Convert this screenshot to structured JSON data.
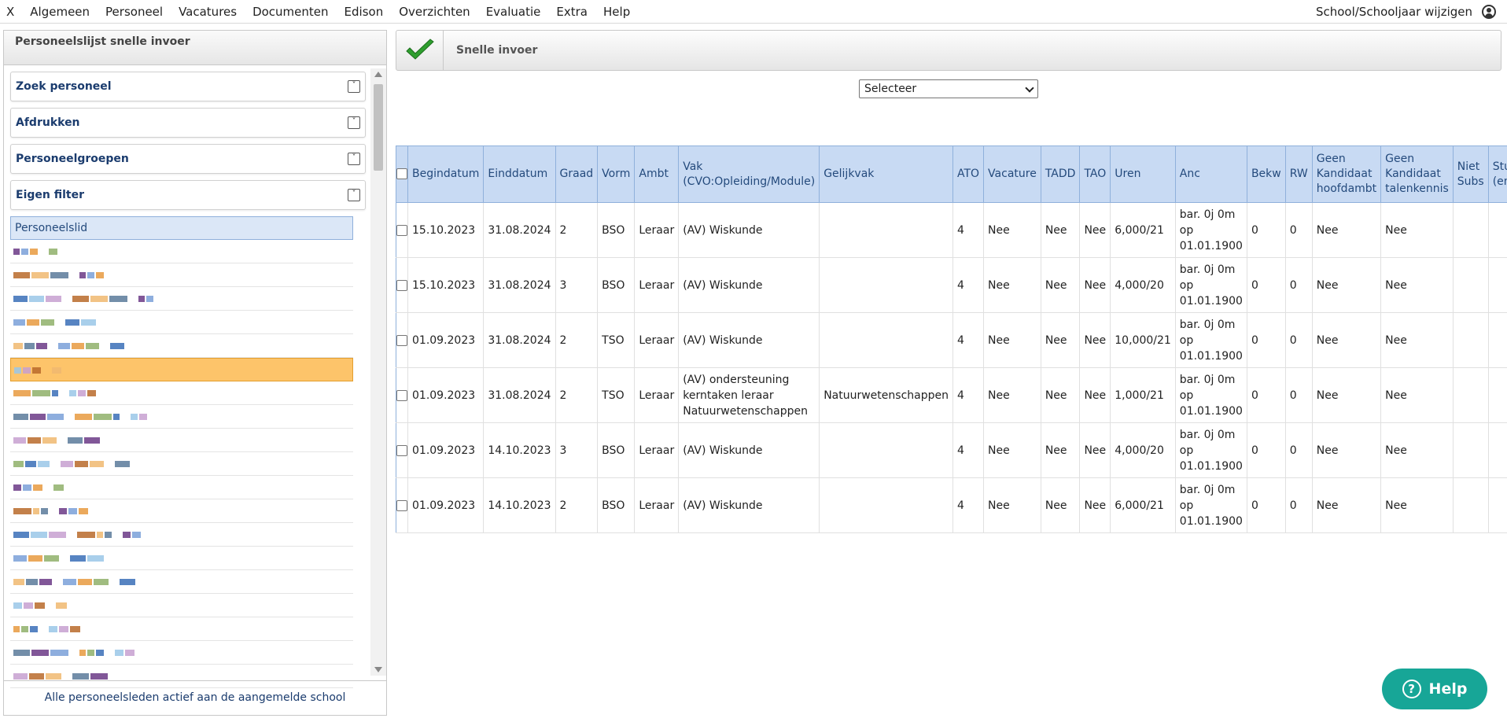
{
  "menubar": {
    "items": [
      "X",
      "Algemeen",
      "Personeel",
      "Vacatures",
      "Documenten",
      "Edison",
      "Overzichten",
      "Evaluatie",
      "Extra",
      "Help"
    ],
    "right_label": "School/Schooljaar wijzigen",
    "user_icon": "user-circle-icon"
  },
  "left_panel": {
    "title": "Personeelslijst snelle invoer",
    "sections": [
      "Zoek personeel",
      "Afdrukken",
      "Personeelgroepen",
      "Eigen filter"
    ],
    "list_header": "Personeelslid",
    "selected_row_index": 5,
    "footer": "Alle personeelsleden actief aan de aangemelde school"
  },
  "toolbar": {
    "title": "Snelle invoer",
    "save_icon": "checkmark-icon"
  },
  "select": {
    "value": "Selecteer"
  },
  "table": {
    "headers": [
      "Begindatum",
      "Einddatum",
      "Graad",
      "Vorm",
      "Ambt",
      "Vak (CVO:Opleiding/Module)",
      "Gelijkvak",
      "ATO",
      "Vacature",
      "TADD",
      "TAO",
      "Uren",
      "Anc",
      "Bekw",
      "RW",
      "Geen Kandidaat hoofdambt",
      "Geen Kandidaat talenkennis",
      "Niet Subs",
      "Studiegebied (enkel CVO)"
    ],
    "rows": [
      [
        "15.10.2023",
        "31.08.2024",
        "2",
        "BSO",
        "Leraar",
        "(AV) Wiskunde",
        "",
        "4",
        "Nee",
        "Nee",
        "Nee",
        "6,000/21",
        "bar. 0j 0m op 01.01.1900",
        "0",
        "0",
        "Nee",
        "Nee",
        "",
        ""
      ],
      [
        "15.10.2023",
        "31.08.2024",
        "3",
        "BSO",
        "Leraar",
        "(AV) Wiskunde",
        "",
        "4",
        "Nee",
        "Nee",
        "Nee",
        "4,000/20",
        "bar. 0j 0m op 01.01.1900",
        "0",
        "0",
        "Nee",
        "Nee",
        "",
        ""
      ],
      [
        "01.09.2023",
        "31.08.2024",
        "2",
        "TSO",
        "Leraar",
        "(AV) Wiskunde",
        "",
        "4",
        "Nee",
        "Nee",
        "Nee",
        "10,000/21",
        "bar. 0j 0m op 01.01.1900",
        "0",
        "0",
        "Nee",
        "Nee",
        "",
        ""
      ],
      [
        "01.09.2023",
        "31.08.2024",
        "2",
        "TSO",
        "Leraar",
        "(AV) ondersteuning kerntaken leraar Natuurwetenschappen",
        "Natuurwetenschappen",
        "4",
        "Nee",
        "Nee",
        "Nee",
        "1,000/21",
        "bar. 0j 0m op 01.01.1900",
        "0",
        "0",
        "Nee",
        "Nee",
        "",
        ""
      ],
      [
        "01.09.2023",
        "14.10.2023",
        "3",
        "BSO",
        "Leraar",
        "(AV) Wiskunde",
        "",
        "4",
        "Nee",
        "Nee",
        "Nee",
        "4,000/20",
        "bar. 0j 0m op 01.01.1900",
        "0",
        "0",
        "Nee",
        "Nee",
        "",
        ""
      ],
      [
        "01.09.2023",
        "14.10.2023",
        "2",
        "BSO",
        "Leraar",
        "(AV) Wiskunde",
        "",
        "4",
        "Nee",
        "Nee",
        "Nee",
        "6,000/21",
        "bar. 0j 0m op 01.01.1900",
        "0",
        "0",
        "Nee",
        "Nee",
        "",
        ""
      ]
    ]
  },
  "help_button": {
    "label": "Help",
    "icon": "question-circle-icon"
  }
}
